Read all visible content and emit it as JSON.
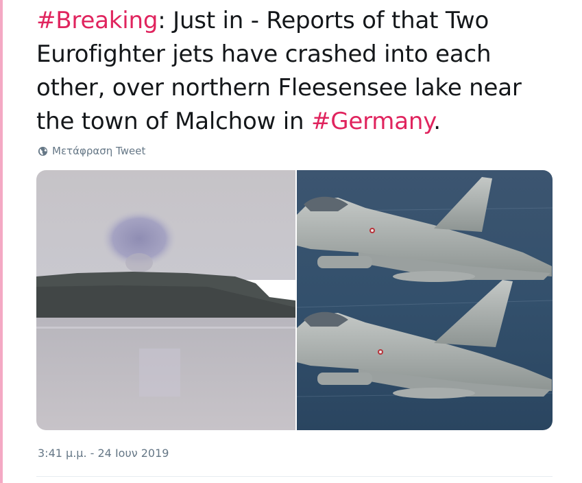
{
  "tweet": {
    "hashtag_1": "#Breaking",
    "text_1": ": Just in - Reports of that Two Eurofighter jets have crashed into each other, over northern Fleesensee lake near the town of Malchow in ",
    "hashtag_2": "#Germany",
    "text_2": ".",
    "translate_label": "Μετάφραση Tweet",
    "timestamp": "3:41 μ.μ. - 24 Ιουν 2019"
  },
  "icons": {
    "translate": "globe-icon"
  },
  "colors": {
    "hashtag": "#e0245e",
    "text": "#14171a",
    "meta": "#657786",
    "accent_bar": "#f4a9c4"
  }
}
